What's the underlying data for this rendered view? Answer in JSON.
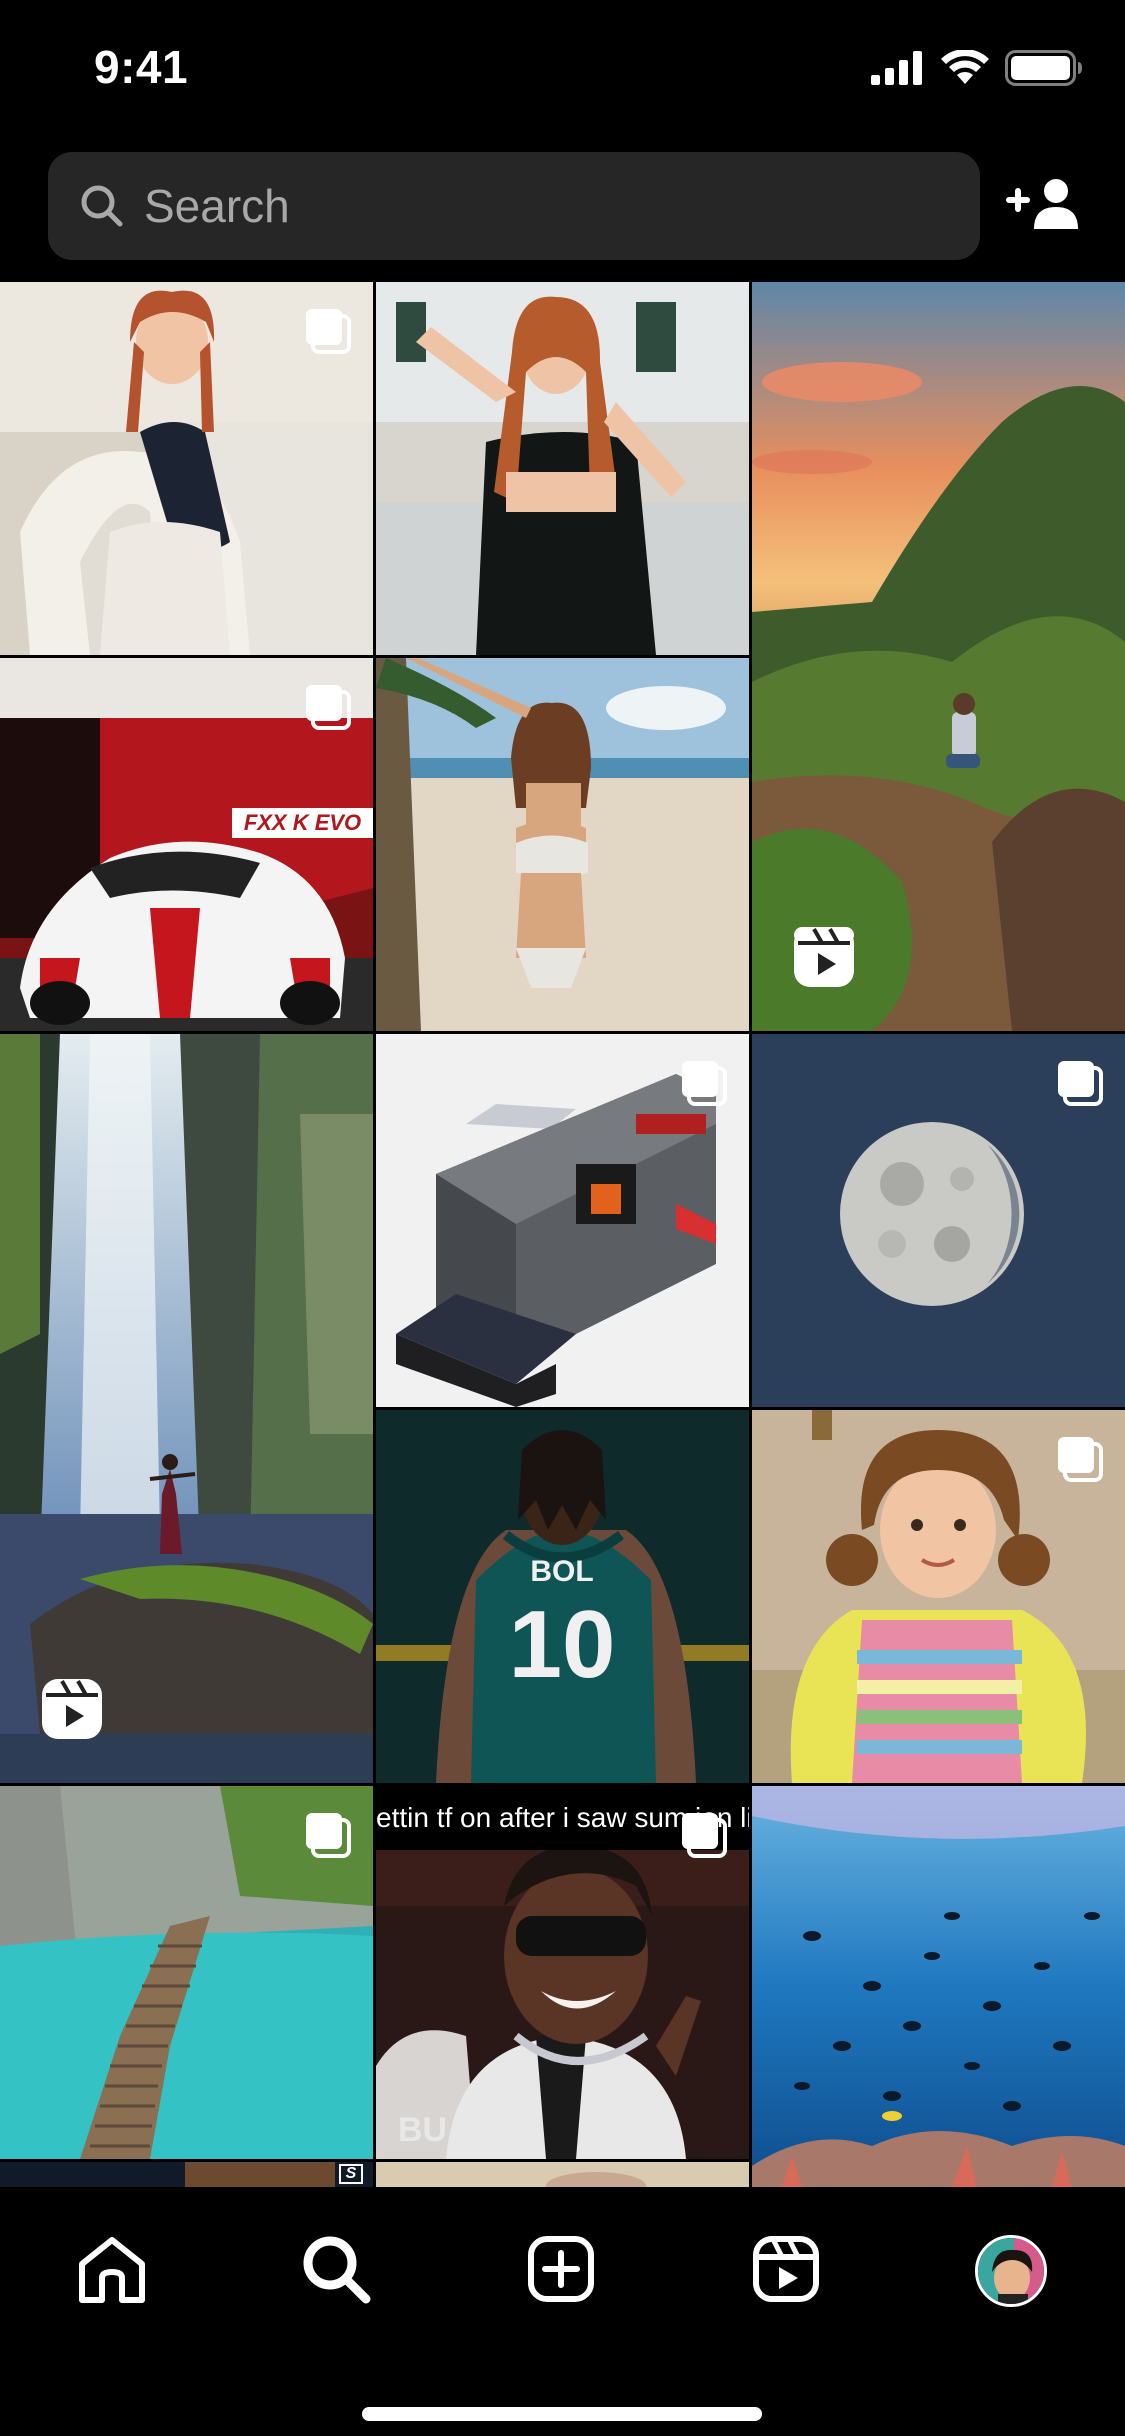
{
  "status_bar": {
    "time": "9:41",
    "icons": [
      "cellular-signal-icon",
      "wifi-icon",
      "battery-icon"
    ]
  },
  "search": {
    "placeholder": "Search",
    "value": ""
  },
  "header_actions": {
    "add_user_icon": "person-plus-icon"
  },
  "grid": {
    "tiles": [
      {
        "id": "tile-1",
        "subject": "woman in white outfit with braids",
        "badge": "carousel"
      },
      {
        "id": "tile-2",
        "subject": "woman in black top",
        "badge": "none"
      },
      {
        "id": "tile-3",
        "subject": "mountain sunset hiker",
        "badge": "reel"
      },
      {
        "id": "tile-4",
        "subject": "red and white race car",
        "badge": "carousel"
      },
      {
        "id": "tile-5",
        "subject": "woman in bikini on beach",
        "badge": "none"
      },
      {
        "id": "tile-6",
        "subject": "waterfall with woman on rock",
        "badge": "reel"
      },
      {
        "id": "tile-7",
        "subject": "brick model building",
        "badge": "carousel"
      },
      {
        "id": "tile-8",
        "subject": "moon",
        "badge": "carousel"
      },
      {
        "id": "tile-9",
        "subject": "basketball player number 10",
        "badge": "none"
      },
      {
        "id": "tile-10",
        "subject": "little girl",
        "badge": "carousel"
      },
      {
        "id": "tile-11",
        "subject": "wooden boardwalk over turquoise water",
        "badge": "carousel"
      },
      {
        "id": "tile-12",
        "subject": "man with sunglasses",
        "badge": "carousel"
      },
      {
        "id": "tile-13",
        "subject": "underwater reef fish",
        "badge": "none"
      }
    ],
    "jersey_name": "BOL",
    "jersey_number": "10",
    "car_sign": "FXX K EVO",
    "caption_overlay": "ettin tf on after i saw sum ion like",
    "photo_text_bu": "BU",
    "s_badge": "S"
  },
  "bottom_nav": {
    "items": [
      {
        "name": "home",
        "icon": "home-icon"
      },
      {
        "name": "explore",
        "icon": "search-icon",
        "active": true
      },
      {
        "name": "create",
        "icon": "plus-square-icon"
      },
      {
        "name": "reels",
        "icon": "reels-icon"
      },
      {
        "name": "profile",
        "icon": "avatar"
      }
    ]
  },
  "colors": {
    "background": "#000000",
    "search_bg": "#262626",
    "placeholder": "#a8a8a8"
  }
}
